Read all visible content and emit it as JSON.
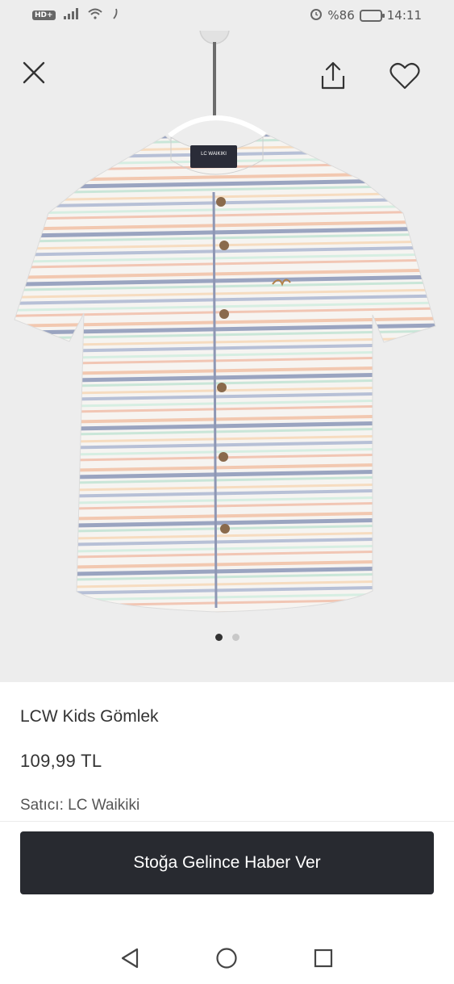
{
  "status_bar": {
    "network_badge": "HD+",
    "battery_percent": "%86",
    "time": "14:11"
  },
  "product": {
    "title": "LCW Kids Gömlek",
    "price": "109,99 TL",
    "seller_label": "Satıcı:",
    "seller_name": "LC Waikiki",
    "label_brand": "LC WAIKIKI",
    "gallery_pages": 2,
    "gallery_active_index": 0
  },
  "actions": {
    "notify_button": "Stoğa Gelince Haber Ver"
  },
  "icons": {
    "close": "close-icon",
    "share": "share-icon",
    "favorite": "heart-icon",
    "back": "back-triangle-icon",
    "home": "home-circle-icon",
    "recents": "recents-square-icon"
  },
  "colors": {
    "button_bg": "#282a30",
    "hero_bg": "#ededed"
  }
}
